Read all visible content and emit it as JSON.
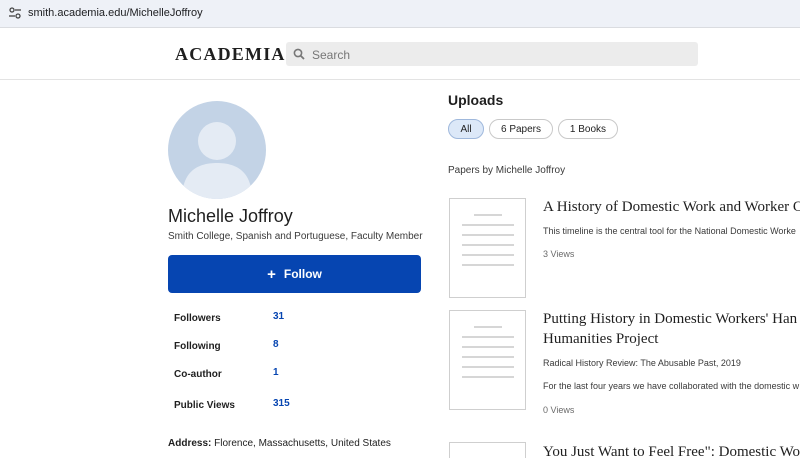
{
  "browser": {
    "url": "smith.academia.edu/MichelleJoffroy"
  },
  "header": {
    "logo": "ACADEMIA",
    "search_placeholder": "Search"
  },
  "profile": {
    "name": "Michelle Joffroy",
    "affiliation": "Smith College, Spanish and Portuguese, Faculty Member",
    "follow_label": "Follow",
    "stats": [
      {
        "label": "Followers",
        "value": "31"
      },
      {
        "label": "Following",
        "value": "8"
      },
      {
        "label": "Co-author",
        "value": "1"
      },
      {
        "label": "Public Views",
        "value": "315"
      }
    ],
    "address_label": "Address:",
    "address_value": "Florence, Massachusetts, United States"
  },
  "uploads": {
    "title": "Uploads",
    "filters": [
      "All",
      "6 Papers",
      "1 Books"
    ],
    "active_filter": "All",
    "papers_by": "Papers by Michelle Joffroy",
    "papers": [
      {
        "title_lines": [
          "A History of Domestic Work and Worker Or"
        ],
        "venue": "",
        "snippet": "This timeline is the central tool for the National Domestic Worke",
        "views": "3 Views"
      },
      {
        "title_lines": [
          "Putting History in Domestic Workers' Han",
          "Humanities Project"
        ],
        "venue": "Radical History Review: The Abusable Past, 2019",
        "snippet": "For the last four years we have collaborated with the domestic w",
        "views": "0 Views"
      },
      {
        "title_lines": [
          "You Just Want to Feel Free\": Domestic Wo"
        ],
        "venue": "",
        "snippet": "",
        "views": ""
      }
    ]
  }
}
